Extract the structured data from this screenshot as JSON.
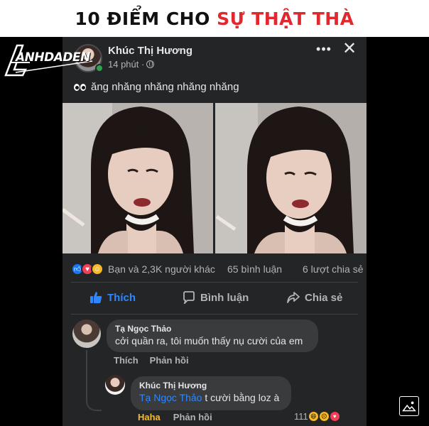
{
  "banner": {
    "title_part1": "10 ĐIỂM CHO ",
    "title_part2": "SỰ THẬT THÀ"
  },
  "watermark": {
    "text": "ANHDADEN"
  },
  "post": {
    "author": "Khúc Thị Hương",
    "time": "14 phút ·",
    "caption": "ăng nhăng nhăng nhăng nhăng",
    "more_label": "•••",
    "close_label": "✕",
    "reactions_summary": "Bạn và 2,3K người khác",
    "comment_count": "65 bình luận",
    "share_count": "6 lượt chia sẻ",
    "actions": {
      "like": "Thích",
      "comment": "Bình luận",
      "share": "Chia sẻ"
    }
  },
  "comments": [
    {
      "author": "Tạ Ngọc Thảo",
      "text": "cởi quần ra, tôi muốn thấy nụ cười của em",
      "actions": [
        "Thích",
        "Phản hồi"
      ]
    }
  ],
  "reply": {
    "author": "Khúc Thị Hương",
    "mention": "Tạ Ngọc Thảo",
    "text": " t cười bằng loz à",
    "actions": [
      "Haha",
      "Phản hồi"
    ],
    "reaction_count": "111"
  },
  "colors": {
    "accent": "#2d88ff",
    "banner_highlight": "#e0282e",
    "background": "#242526",
    "bubble": "#3a3b3c"
  }
}
